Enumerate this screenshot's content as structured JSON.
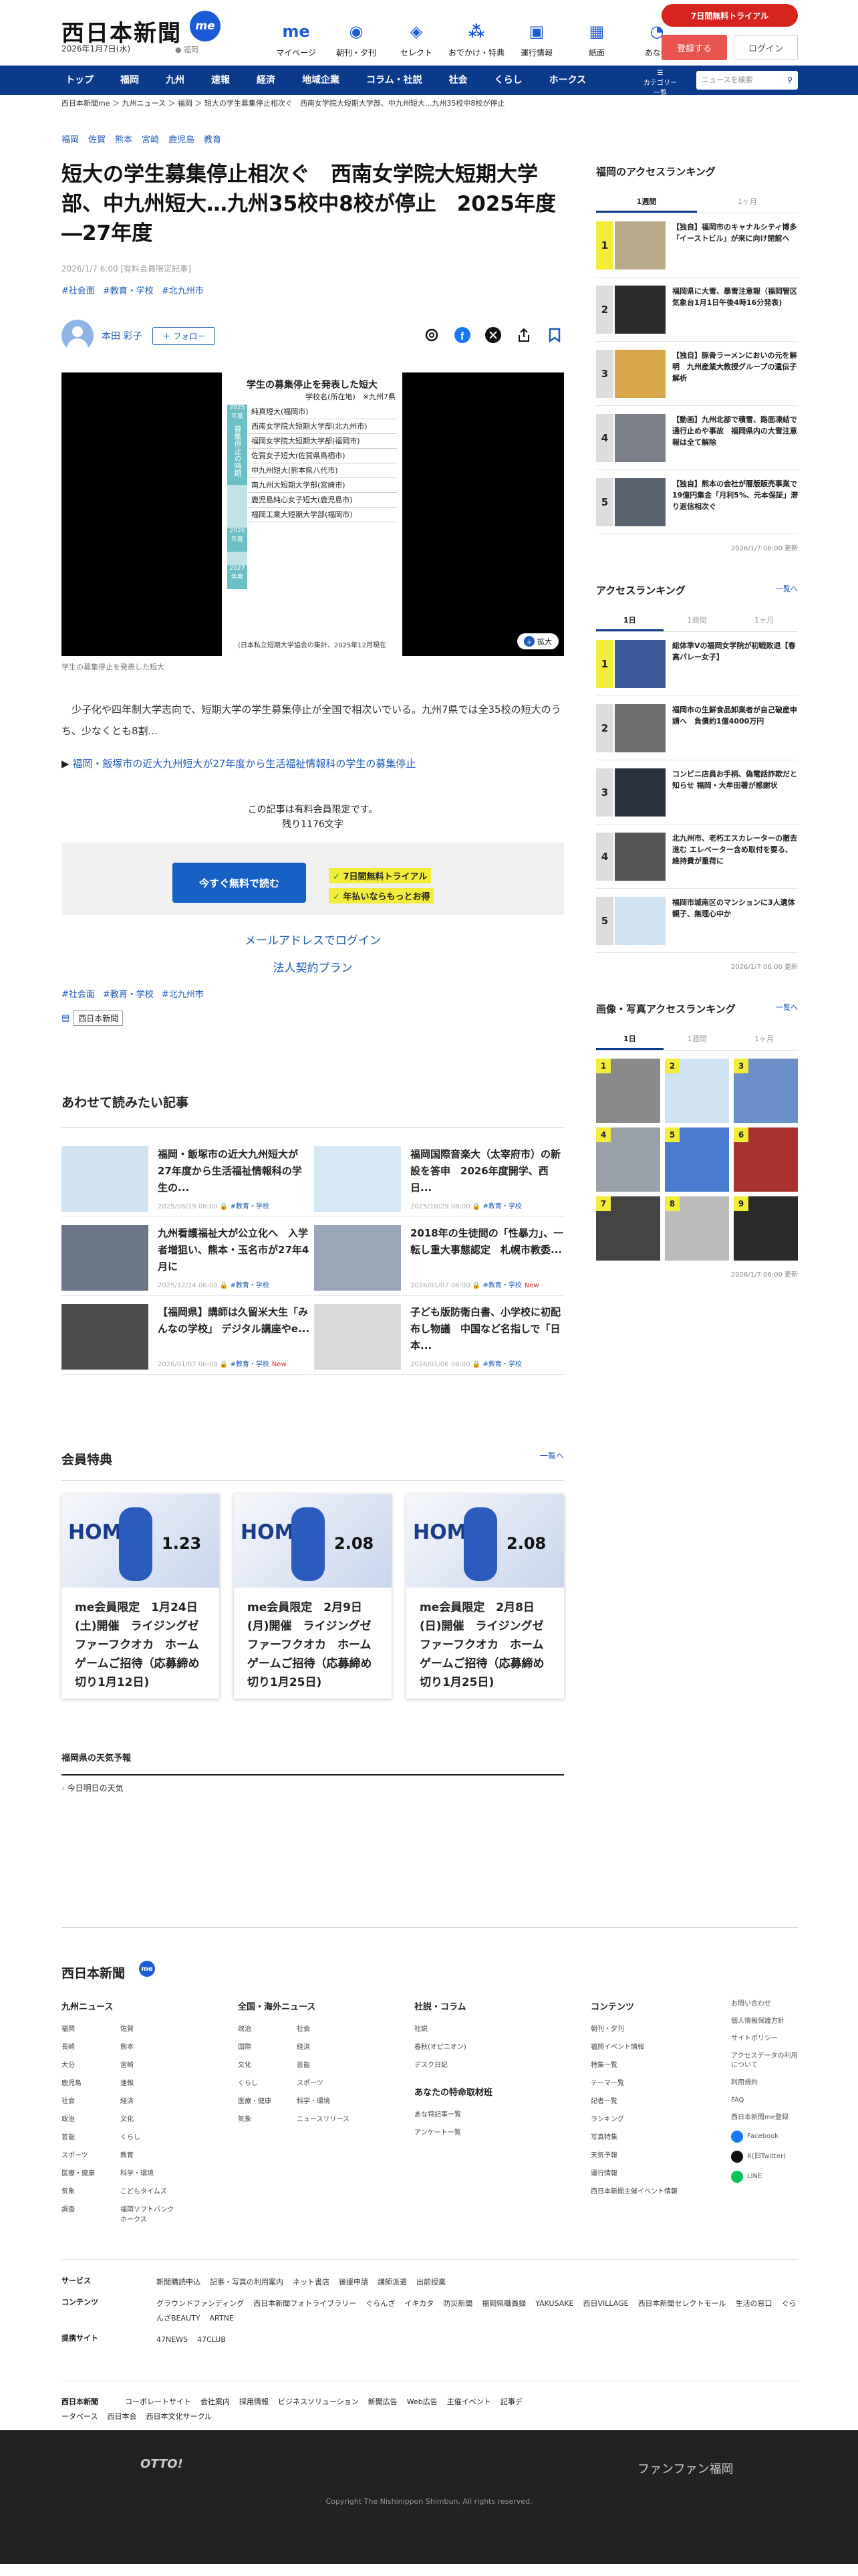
{
  "header": {
    "logo": "西日本新聞",
    "logo_me": "me",
    "date": "2026年1月7日(水)",
    "location": "福岡",
    "nav": [
      {
        "label": "マイページ",
        "icon": "me-icon"
      },
      {
        "label": "朝刊・夕刊",
        "icon": "newspaper-icon"
      },
      {
        "label": "セレクト",
        "icon": "select-icon"
      },
      {
        "label": "おでかけ・特典",
        "icon": "footprint-icon"
      },
      {
        "label": "運行情報",
        "icon": "train-icon"
      },
      {
        "label": "紙面",
        "icon": "paper-icon"
      },
      {
        "label": "あな特",
        "icon": "dog-icon"
      }
    ],
    "trial": "7日間無料トライアル",
    "register": "登録する",
    "login": "ログイン"
  },
  "gnav": {
    "items": [
      "トップ",
      "福岡",
      "九州",
      "速報",
      "経済",
      "地域企業",
      "コラム・社説",
      "社会",
      "くらし",
      "ホークス"
    ],
    "category": "カテゴリー一覧",
    "search_placeholder": "ニュースを検索"
  },
  "breadcrumb": "西日本新聞me ＞ 九州ニュース ＞ 福岡 ＞ 短大の学生募集停止相次ぐ　西南女学院大短期大学部、中九州短大...九州35校中8校が停止",
  "article": {
    "region_tags": [
      "福岡",
      "佐賀",
      "熊本",
      "宮崎",
      "鹿児島",
      "教育"
    ],
    "title": "短大の学生募集停止相次ぐ　西南女学院大短期大学部、中九州短大…九州35校中8校が停止　2025年度―27年度",
    "meta": "2026/1/7 6:00 [有料会員限定記事]",
    "tags": [
      "#社会面",
      "#教育・学校",
      "#北九州市"
    ],
    "author": "本田 彩子",
    "follow": "＋ フォロー",
    "figure": {
      "title": "学生の募集停止を発表した短大",
      "sub": "学校名(所在地)　※九州7県",
      "periods": [
        "2025年度",
        "2026年度",
        "2027年度"
      ],
      "side_label": "募集停止の時期",
      "rows": [
        "純真短大(福岡市)",
        "西南女学院大短期大学部(北九州市)",
        "福岡女学院大短期大学部(福岡市)",
        "佐賀女子短大(佐賀県鳥栖市)",
        "中九州短大(熊本県八代市)",
        "南九州大短期大学部(宮崎市)",
        "鹿児島純心女子短大(鹿児島市)",
        "福岡工業大短期大学部(福岡市)"
      ],
      "note": "(日本私立短期大学協会の集計、2025年12月現在",
      "zoom": "拡大"
    },
    "caption": "学生の募集停止を発表した短大",
    "body": "少子化や四年制大学志向で、短期大学の学生募集停止が全国で相次いでいる。九州7県では全35校の短大のうち、少なくとも8割...",
    "related_link": "福岡・飯塚市の近大九州短大が27年度から生活福祉情報科の学生の募集停止",
    "paywall1": "この記事は有料会員限定です。",
    "paywall2": "残り1176文字",
    "read_free": "今すぐ無料で読む",
    "perk1": "7日間無料トライアル",
    "perk2": "年払いならもっとお得",
    "mail_login": "メールアドレスでログイン",
    "corp": "法人契約プラン",
    "source": "西日本新聞"
  },
  "related": {
    "heading": "あわせて読みたい記事",
    "items": [
      {
        "title": "福岡・飯塚市の近大九州短大が27年度から生活福祉情報科の学生の...",
        "date": "2025/06/19 06:00",
        "tag": "#教育・学校",
        "new": ""
      },
      {
        "title": "福岡国際音楽大（太宰府市）の新設を答申　2026年度開学、西日...",
        "date": "2025/10/29 06:00",
        "tag": "#教育・学校",
        "new": ""
      },
      {
        "title": "九州看護福祉大が公立化へ　入学者増狙い、熊本・玉名市が27年4月に",
        "date": "2025/12/24 06:00",
        "tag": "#教育・学校",
        "new": ""
      },
      {
        "title": "2018年の生徒間の「性暴力」、一転し重大事態認定　札幌市教委...",
        "date": "2026/01/07 06:00",
        "tag": "#教育・学校",
        "new": "New"
      },
      {
        "title": "【福岡県】講師は久留米大生「みんなの学校」 デジタル講座やe...",
        "date": "2026/01/07 06:00",
        "tag": "#教育・学校",
        "new": "New"
      },
      {
        "title": "子ども版防衛白書、小学校に初配布し物議　中国など名指しで「日本...",
        "date": "2026/01/06 06:00",
        "tag": "#教育・学校",
        "new": ""
      }
    ]
  },
  "member": {
    "heading": "会員特典",
    "more": "一覧へ",
    "cards": [
      {
        "date": "1.23",
        "text": "me会員限定　1月24日(土)開催　ライジングゼファーフクオカ　ホームゲームご招待（応募締め切り1月12日)"
      },
      {
        "date": "2.08",
        "text": "me会員限定　2月9日(月)開催　ライジングゼファーフクオカ　ホームゲームご招待（応募締め切り1月25日)"
      },
      {
        "date": "2.08",
        "text": "me会員限定　2月8日(日)開催　ライジングゼファーフクオカ　ホームゲームご招待（応募締め切り1月25日)"
      }
    ]
  },
  "weather": {
    "heading": "福岡県の天気予報",
    "row": "今日明日の天気"
  },
  "sidebar": {
    "access": {
      "title": "福岡のアクセスランキング",
      "tabs": [
        "1週間",
        "1ヶ月"
      ],
      "items": [
        "【独自】福岡市のキャナルシティ博多「イーストビル」が来に向け閉館へ",
        "福岡県に大雪、暴雪注意報（福岡管区気象台1月1日午後4時16分発表)",
        "【独自】豚骨ラーメンにおいの元を解明　九州産業大教授グループの遺伝子解析",
        "【動画】九州北部で積雪、路面凍結で通行止めや事故　福岡県内の大雪注意報は全て解除",
        "【独自】熊本の会社が暦版販売事業で19億円集金「月利5%、元本保証」滞り返信相次ぐ"
      ],
      "updated": "2026/1/7 06:00 更新"
    },
    "access2": {
      "title": "アクセスランキング",
      "more": "一覧へ",
      "tabs": [
        "1日",
        "1週間",
        "1ヶ月"
      ],
      "items": [
        "総体準Vの福岡女学院が初戦敗退【春高バレー女子】",
        "福岡市の生鮮食品卸業者が自己破産申請へ　負債約1億4000万円",
        "コンビニ店員お手柄、偽電話詐欺だと知らせ 福岡・大牟田署が感謝状",
        "北九州市、老朽エスカレーターの撤去進む エレベーター含め取付を要る、維持費が重荷に",
        "福岡市城南区のマンションに3人遺体　親子、無理心中か"
      ],
      "updated": "2026/1/7 06:00 更新"
    },
    "photo": {
      "title": "画像・写真アクセスランキング",
      "more": "一覧へ",
      "tabs": [
        "1日",
        "1週間",
        "1ヶ月"
      ],
      "nums": [
        "1",
        "2",
        "3",
        "4",
        "5",
        "6",
        "7",
        "8",
        "9"
      ],
      "updated": "2026/1/7 06:00 更新"
    }
  },
  "footer": {
    "logo": "西日本新聞",
    "cols": [
      {
        "title": "九州ニュース",
        "links": [
          "福岡",
          "佐賀",
          "長崎",
          "熊本",
          "大分",
          "宮崎",
          "鹿児島",
          "速報",
          "社会",
          "経済",
          "政治",
          "文化",
          "芸能",
          "くらし",
          "スポーツ",
          "教育",
          "医療・健康",
          "科学・環境",
          "気象",
          "こどもタイムズ",
          "調査",
          "福岡ソフトバンクホークス"
        ]
      },
      {
        "title": "全国・海外ニュース",
        "links": [
          "政治",
          "社会",
          "国際",
          "経済",
          "文化",
          "芸能",
          "くらし",
          "スポーツ",
          "医療・健康",
          "科学・環境",
          "気象",
          "ニュースリリース"
        ]
      },
      {
        "title": "社説・コラム",
        "links": [
          "社説",
          "春秋(オピニオン)",
          "デスク日記"
        ],
        "sub_title": "あなたの特命取材班",
        "sub_links": [
          "あな特記事一覧",
          "アンケート一覧"
        ]
      },
      {
        "title": "コンテンツ",
        "links": [
          "朝刊・夕刊",
          "福岡イベント情報",
          "特集一覧",
          "テーマ一覧",
          "記者一覧",
          "ランキング",
          "写真特集",
          "天気予報",
          "運行情報",
          "西日本新聞主催イベント情報"
        ]
      }
    ],
    "side": [
      "お問い合わせ",
      "個人情報保護方針",
      "サイトポリシー",
      "アクセスデータの利用について",
      "利用規約",
      "FAQ",
      "西日本新聞me登録"
    ],
    "sns": [
      "Facebook",
      "X(旧Twitter)",
      "LINE"
    ],
    "services": [
      {
        "label": "サービス",
        "links": [
          "新聞購読申込",
          "記事・写真の利用案内",
          "ネット書店",
          "後援申請",
          "講師派遣",
          "出前授業"
        ]
      },
      {
        "label": "コンテンツ",
        "links": [
          "グラウンドファンディング",
          "西日本新聞フォトライブラリー",
          "ぐらんざ",
          "イキカタ",
          "防災新聞",
          "福岡県職員録",
          "YAKUSAKE",
          "西日VILLAGE",
          "西日本新聞セレクトモール",
          "生活の窓口",
          "ぐらんざBEAUTY",
          "ARTNE"
        ]
      },
      {
        "label": "提携サイト",
        "links": [
          "47NEWS",
          "47CLUB"
        ]
      }
    ],
    "corp": [
      "西日本新聞",
      "コーポレートサイト",
      "会社案内",
      "採用情報",
      "ビジネスソリューション",
      "新聞広告",
      "Web広告",
      "主催イベント",
      "記事データベース",
      "西日本会",
      "西日本文化サークル"
    ],
    "otto": "OTTO!",
    "fanfan": "ファンファン福岡",
    "copyright": "Copyright The Nishinippon Shimbun, All rights reserved."
  }
}
